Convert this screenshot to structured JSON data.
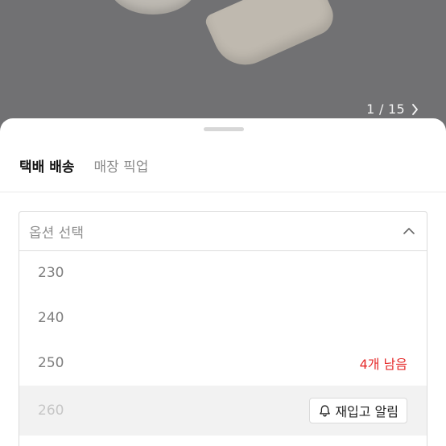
{
  "gallery": {
    "counter": "1 / 15",
    "next_icon": "chevron-right-icon"
  },
  "tabs": [
    {
      "label": "택배 배송",
      "active": true
    },
    {
      "label": "매장 픽업",
      "active": false
    }
  ],
  "select": {
    "label": "옵션 선택",
    "icon": "chevron-up-icon"
  },
  "options": [
    {
      "size": "230",
      "status": ""
    },
    {
      "size": "240",
      "status": ""
    },
    {
      "size": "250",
      "status": "4개 남음"
    },
    {
      "size": "260",
      "status": "",
      "action": "재입고 알림"
    }
  ],
  "colors": {
    "stock_warning": "#e52b2b",
    "disabled_bg": "#f2f2f2"
  }
}
